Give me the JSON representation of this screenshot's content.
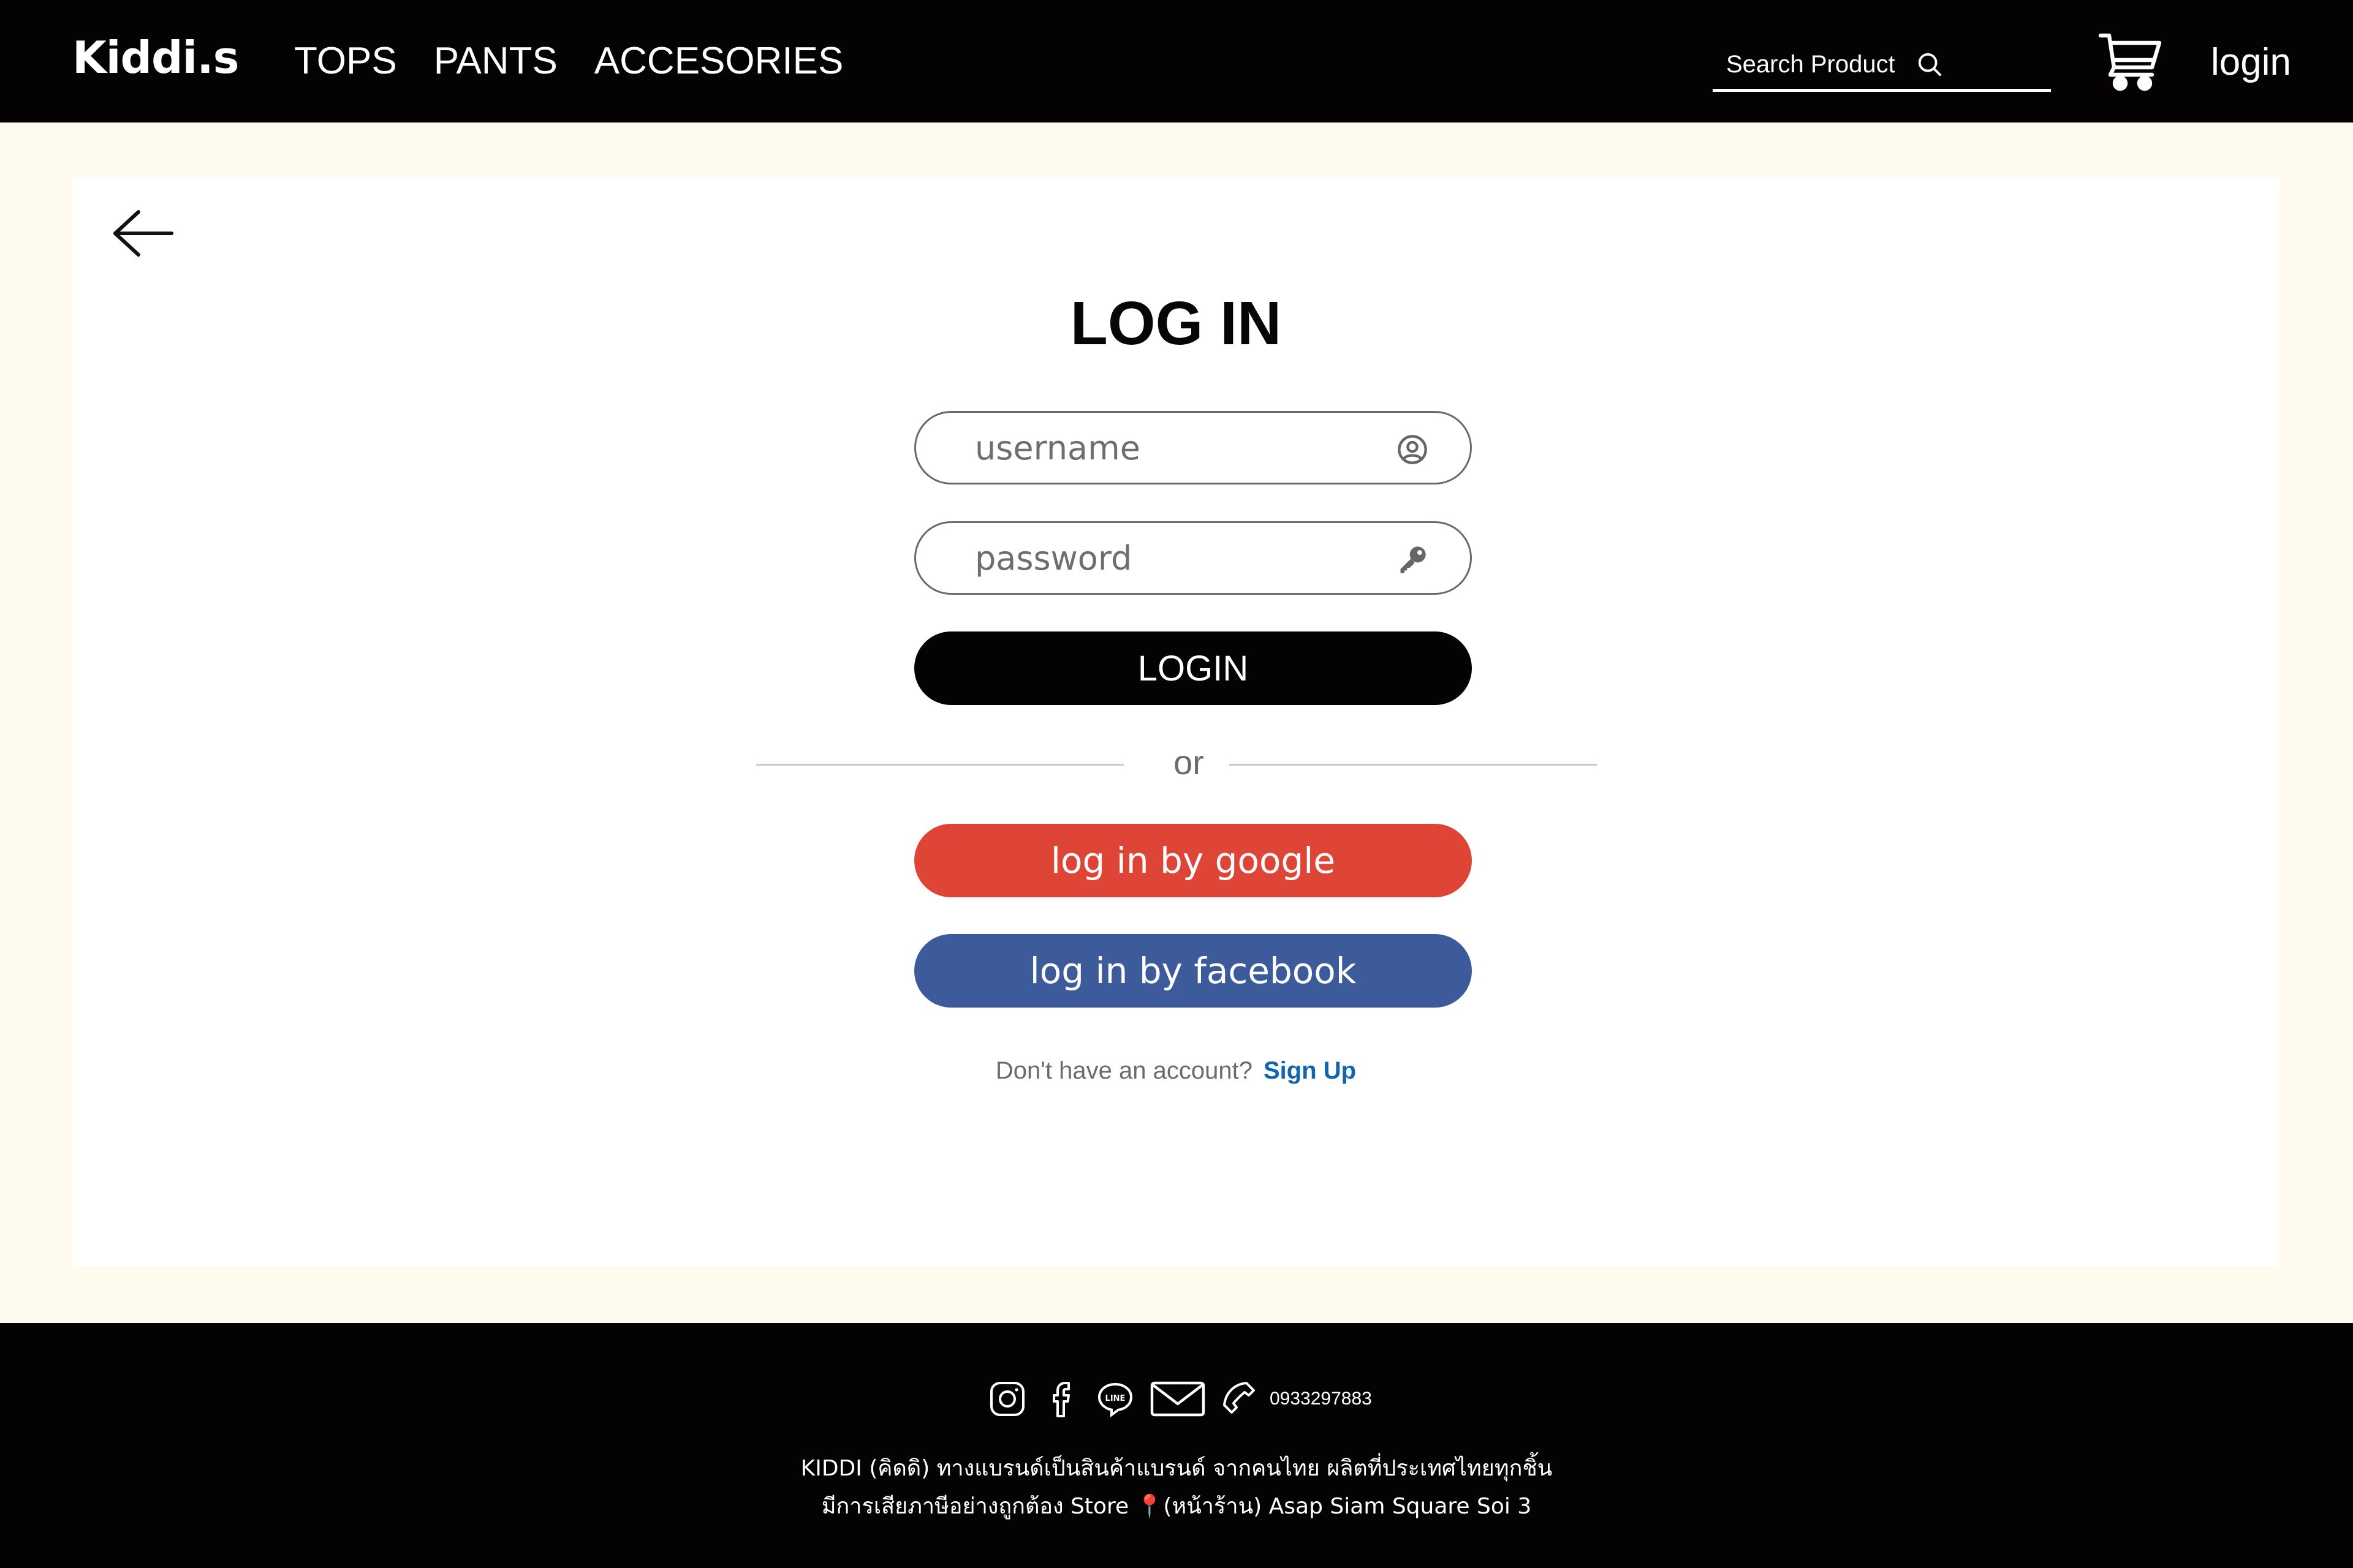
{
  "header": {
    "logo": "Kiddi.s",
    "nav": [
      {
        "label": "TOPS"
      },
      {
        "label": "PANTS"
      },
      {
        "label": "ACCESORIES"
      }
    ],
    "search_placeholder": "Search Product",
    "login_label": "login"
  },
  "login_form": {
    "title": "LOG IN",
    "username_placeholder": "username",
    "password_placeholder": "password",
    "login_button": "LOGIN",
    "or_text": "or",
    "google_button": "log in by google",
    "facebook_button": "log in by facebook",
    "signup_prompt": "Don't have an account?",
    "signup_link": "Sign Up"
  },
  "footer": {
    "phone": "0933297883",
    "line1": "KIDDI (คิดดิ) ทางแบรนด์เป็นสินค้าแบรนด์ จากคนไทย ผลิตที่ประเทศไทยทุกชิ้น",
    "line2": "มีการเสียภาษีอย่างถูกต้อง Store 📍(หน้าร้าน) Asap Siam Square Soi 3"
  },
  "colors": {
    "header_bg": "#050203",
    "page_bg": "#fffaee",
    "google": "#de4537",
    "facebook": "#3d5b9b",
    "signup_link": "#1064b0"
  },
  "icons": [
    "search-icon",
    "cart-icon",
    "back-arrow-icon",
    "user-circle-icon",
    "key-icon",
    "instagram-icon",
    "facebook-icon",
    "line-icon",
    "mail-icon",
    "phone-icon"
  ]
}
